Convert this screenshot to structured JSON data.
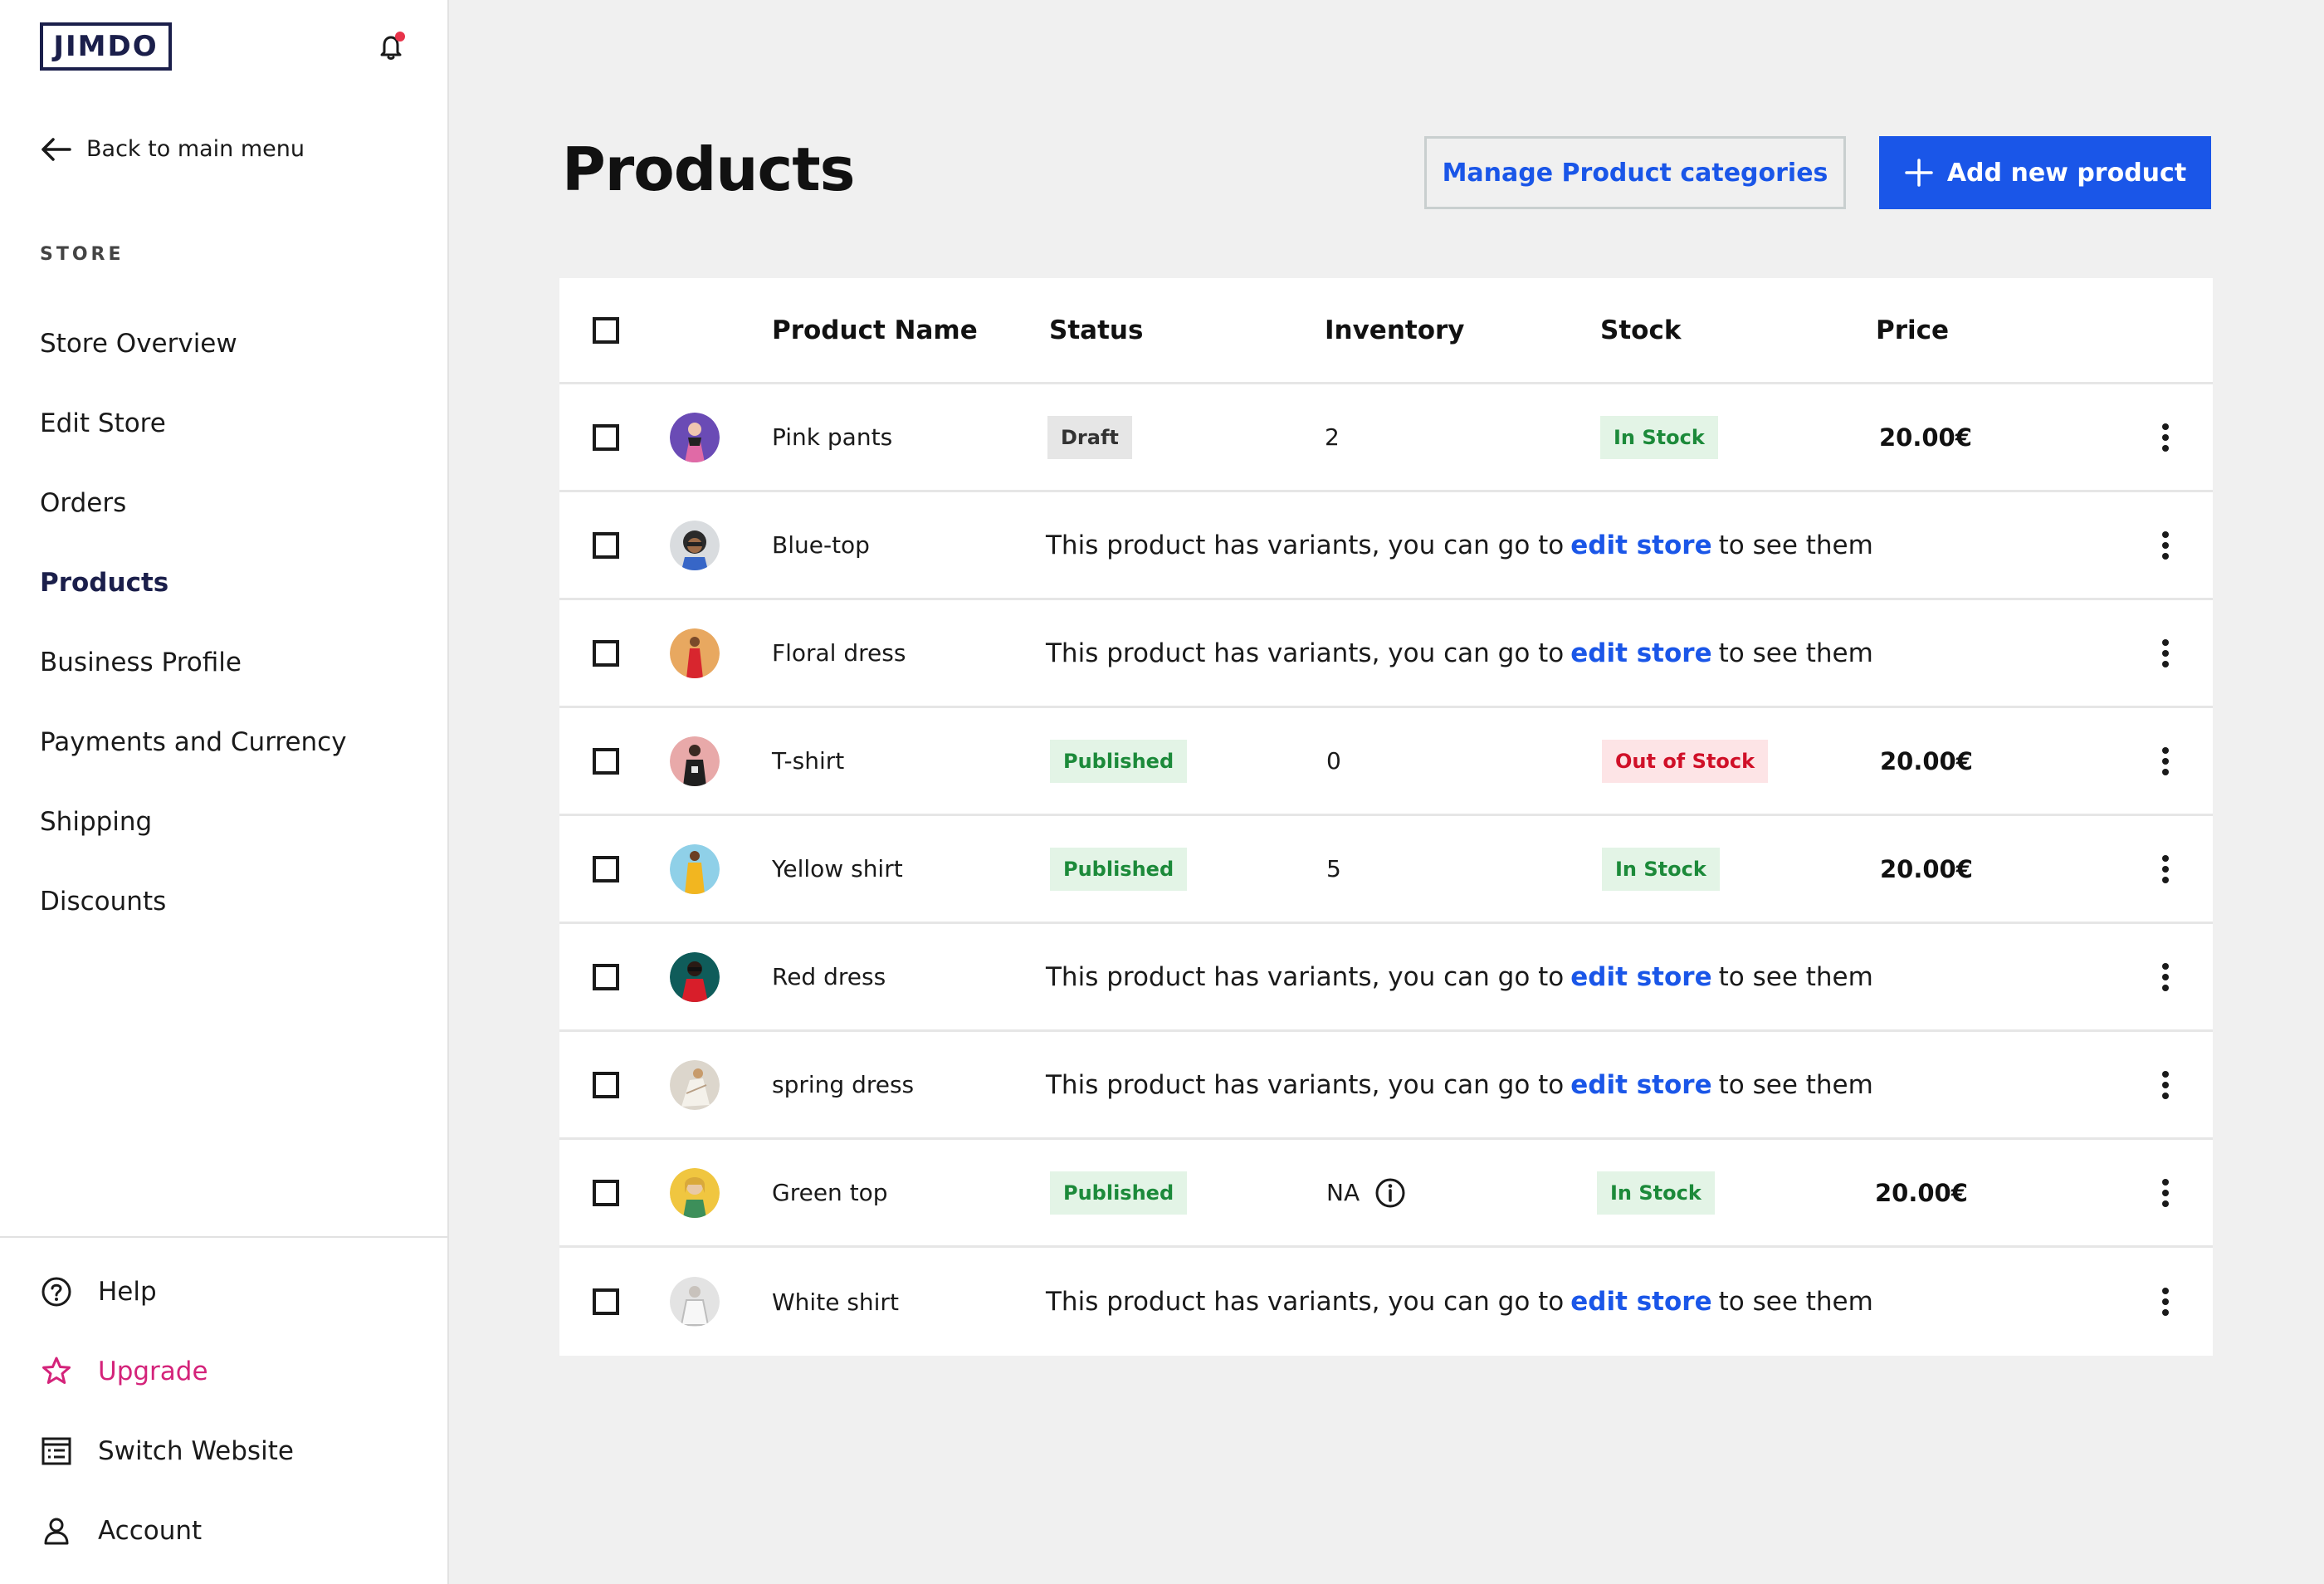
{
  "brand": {
    "logo_text": "JIMDO"
  },
  "sidebar": {
    "back_label": "Back to main menu",
    "section_label": "STORE",
    "items": [
      {
        "label": "Store Overview",
        "active": false
      },
      {
        "label": "Edit Store",
        "active": false
      },
      {
        "label": "Orders",
        "active": false
      },
      {
        "label": "Products",
        "active": true
      },
      {
        "label": "Business Profile",
        "active": false
      },
      {
        "label": "Payments and Currency",
        "active": false
      },
      {
        "label": "Shipping",
        "active": false
      },
      {
        "label": "Discounts",
        "active": false
      }
    ],
    "bottom": [
      {
        "label": "Help",
        "icon": "help-icon"
      },
      {
        "label": "Upgrade",
        "icon": "star-icon"
      },
      {
        "label": "Switch Website",
        "icon": "website-list-icon"
      },
      {
        "label": "Account",
        "icon": "user-icon"
      }
    ]
  },
  "header": {
    "title": "Products",
    "manage_categories_label": "Manage Product categories",
    "add_product_label": "Add new product"
  },
  "table": {
    "columns": {
      "name": "Product Name",
      "status": "Status",
      "inventory": "Inventory",
      "stock": "Stock",
      "price": "Price"
    },
    "variants_text": {
      "prefix": "This product has variants, you can go to",
      "link": "edit store",
      "suffix": "to see them"
    },
    "rows": [
      {
        "name": "Pink pants",
        "status": "Draft",
        "inventory": "2",
        "stock": "In Stock",
        "price": "20.00€"
      },
      {
        "name": "Blue-top",
        "has_variants": true
      },
      {
        "name": "Floral dress",
        "has_variants": true
      },
      {
        "name": "T-shirt",
        "status": "Published",
        "inventory": "0",
        "stock": "Out of Stock",
        "price": "20.00€"
      },
      {
        "name": "Yellow shirt",
        "status": "Published",
        "inventory": "5",
        "stock": "In Stock",
        "price": "20.00€"
      },
      {
        "name": "Red dress",
        "has_variants": true
      },
      {
        "name": "spring dress",
        "has_variants": true
      },
      {
        "name": "Green top",
        "status": "Published",
        "inventory": "NA",
        "inventory_info_icon": true,
        "stock": "In Stock",
        "price": "20.00€"
      },
      {
        "name": "White shirt",
        "has_variants": true
      }
    ]
  },
  "colors": {
    "accent": "#1a56e8",
    "brand_navy": "#1b1f4b",
    "upgrade_pink": "#d4237a",
    "notification_dot": "#e8334a",
    "success": "#1c8a3a",
    "danger": "#d01028"
  }
}
